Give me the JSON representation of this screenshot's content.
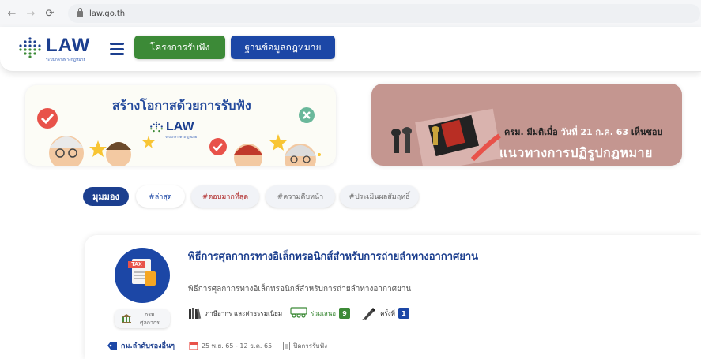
{
  "browser": {
    "back_icon": "arrow-left-icon",
    "forward_icon": "arrow-right-icon",
    "reload_icon": "reload-icon",
    "url": "law.go.th"
  },
  "header": {
    "logo_text": "LAW",
    "logo_sub": "ระบบกลางทางกฎหมาย",
    "btn_hearing": "โครงการรับฟัง",
    "btn_database": "ฐานข้อมูลกฎหมาย"
  },
  "banners": {
    "left_title": "สร้างโอกาสด้วยการรับฟัง",
    "left_logo": "LAW",
    "left_logo_sub": "ระบบกลางทางกฎหมาย",
    "right_line1_a": "ครม. มีมติเมื่อ ",
    "right_line1_b": "วันที่ 21 ก.ค. 63 ",
    "right_line1_c": "เห็นชอบ",
    "right_line2": "แนวทางการปฏิรูปกฎหมาย"
  },
  "filters": {
    "label": "มุมมอง",
    "tabs": [
      "#ล่าสุด",
      "#ตอบมากที่สุด",
      "#ความคืบหน้า",
      "#ประเมินผลสัมฤทธิ์"
    ]
  },
  "card": {
    "title": "พิธีการศุลกากรทางอิเล็กทรอนิกส์สำหรับการถ่ายลำทางอากาศยาน",
    "description": "พิธีการศุลกากรทางอิเล็กทรอนิกส์สำหรับการถ่ายลำทางอากาศยาน",
    "dept_line1": "กรม",
    "dept_line2": "ศุลกากร",
    "category": "ภาษีอากร และค่าธรรมเนียม",
    "join_label": "ร่วมเสนอ",
    "join_count": "9",
    "round_label": "ครั้งที่",
    "round_count": "1",
    "tag": "กม.ลำดับรองอื่นๆ",
    "date_range": "25 พ.ย. 65 - 12 ธ.ค. 65",
    "status": "ปิดการรับฟัง"
  },
  "colors": {
    "brand_blue": "#1c3f8f",
    "btn_blue": "#1c47a6",
    "green": "#3c8a37",
    "banner_right_bg": "#c49690"
  }
}
